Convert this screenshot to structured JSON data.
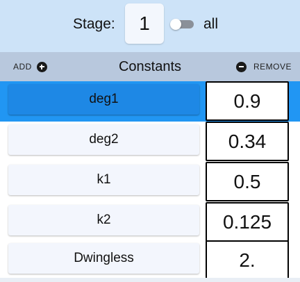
{
  "stage": {
    "label": "Stage:",
    "value": "1",
    "toggle_label": "all",
    "toggle_on": false
  },
  "header": {
    "add_label": "ADD",
    "title": "Constants",
    "remove_label": "REMOVE"
  },
  "constants": [
    {
      "name": "deg1",
      "value": "0.9",
      "selected": true
    },
    {
      "name": "deg2",
      "value": "0.34",
      "selected": false
    },
    {
      "name": "k1",
      "value": "0.5",
      "selected": false
    },
    {
      "name": "k2",
      "value": "0.125",
      "selected": false
    },
    {
      "name": "Dwingless",
      "value": "2.",
      "selected": false
    }
  ],
  "colors": {
    "stage_bar": "#cde3f8",
    "header_bar": "#b8c8dd",
    "selected_row": "#2196f3",
    "selected_button": "#1e88e5"
  }
}
